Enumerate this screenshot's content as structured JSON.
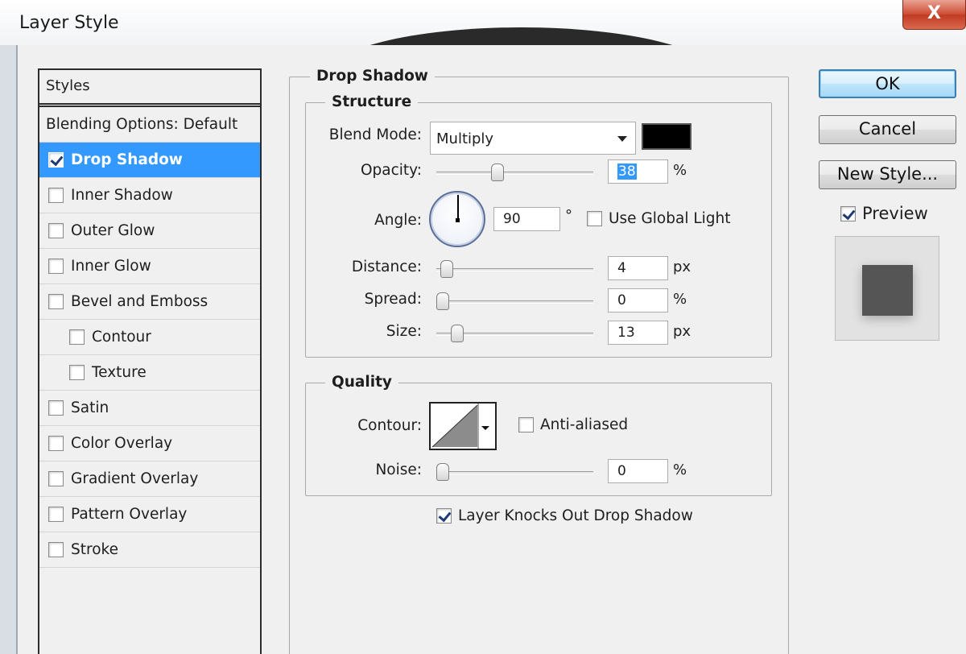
{
  "window": {
    "title": "Layer Style",
    "close_glyph": "X"
  },
  "styles_panel": {
    "header": "Styles",
    "blending_options": "Blending Options: Default",
    "items": [
      {
        "label": "Drop Shadow",
        "checked": true,
        "selected": true,
        "indent": false
      },
      {
        "label": "Inner Shadow",
        "checked": false,
        "selected": false,
        "indent": false
      },
      {
        "label": "Outer Glow",
        "checked": false,
        "selected": false,
        "indent": false
      },
      {
        "label": "Inner Glow",
        "checked": false,
        "selected": false,
        "indent": false
      },
      {
        "label": "Bevel and Emboss",
        "checked": false,
        "selected": false,
        "indent": false
      },
      {
        "label": "Contour",
        "checked": false,
        "selected": false,
        "indent": true
      },
      {
        "label": "Texture",
        "checked": false,
        "selected": false,
        "indent": true
      },
      {
        "label": "Satin",
        "checked": false,
        "selected": false,
        "indent": false
      },
      {
        "label": "Color Overlay",
        "checked": false,
        "selected": false,
        "indent": false
      },
      {
        "label": "Gradient Overlay",
        "checked": false,
        "selected": false,
        "indent": false
      },
      {
        "label": "Pattern Overlay",
        "checked": false,
        "selected": false,
        "indent": false
      },
      {
        "label": "Stroke",
        "checked": false,
        "selected": false,
        "indent": false
      }
    ]
  },
  "drop_shadow": {
    "title": "Drop Shadow",
    "structure": {
      "title": "Structure",
      "blend_mode_label": "Blend Mode:",
      "blend_mode_value": "Multiply",
      "shadow_color": "#000000",
      "opacity_label": "Opacity:",
      "opacity_value": "38",
      "opacity_unit": "%",
      "opacity_level": 0.38,
      "angle_label": "Angle:",
      "angle_value": "90",
      "angle_unit": "°",
      "use_global_light_label": "Use Global Light",
      "use_global_light": false,
      "distance_label": "Distance:",
      "distance_value": "4",
      "distance_unit": "px",
      "distance_level": 0.03,
      "spread_label": "Spread:",
      "spread_value": "0",
      "spread_unit": "%",
      "spread_level": 0,
      "size_label": "Size:",
      "size_value": "13",
      "size_unit": "px",
      "size_level": 0.1
    },
    "quality": {
      "title": "Quality",
      "contour_label": "Contour:",
      "anti_aliased_label": "Anti-aliased",
      "anti_aliased": false,
      "noise_label": "Noise:",
      "noise_value": "0",
      "noise_unit": "%",
      "noise_level": 0
    },
    "layer_knocks_out_label": "Layer Knocks Out Drop Shadow",
    "layer_knocks_out": true
  },
  "buttons": {
    "ok": "OK",
    "cancel": "Cancel",
    "new_style": "New Style...",
    "preview_label": "Preview",
    "preview_checked": true
  },
  "colors": {
    "selection": "#3399ff",
    "preview_swatch": "#555555",
    "close_button": "#c94a33"
  }
}
